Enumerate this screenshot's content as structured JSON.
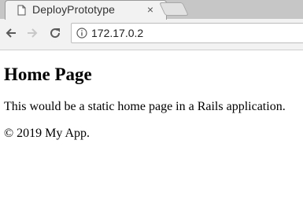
{
  "browser": {
    "tab": {
      "title": "DeployPrototype",
      "icon": "document-icon",
      "close_glyph": "×"
    },
    "new_tab_icon": "new-tab-icon",
    "toolbar": {
      "back_icon": "back-arrow-icon",
      "forward_icon": "forward-arrow-icon",
      "reload_icon": "reload-icon",
      "info_icon": "info-icon",
      "url": "172.17.0.2"
    }
  },
  "page": {
    "title": "Home Page",
    "text": "This would be a static home page in a Rails application.",
    "footer": "© 2019 My App."
  },
  "colors": {
    "tabstrip": "#c6c6c6",
    "toolbar": "#f2f2f2",
    "page_background": "#ffffff",
    "text": "#000000"
  }
}
